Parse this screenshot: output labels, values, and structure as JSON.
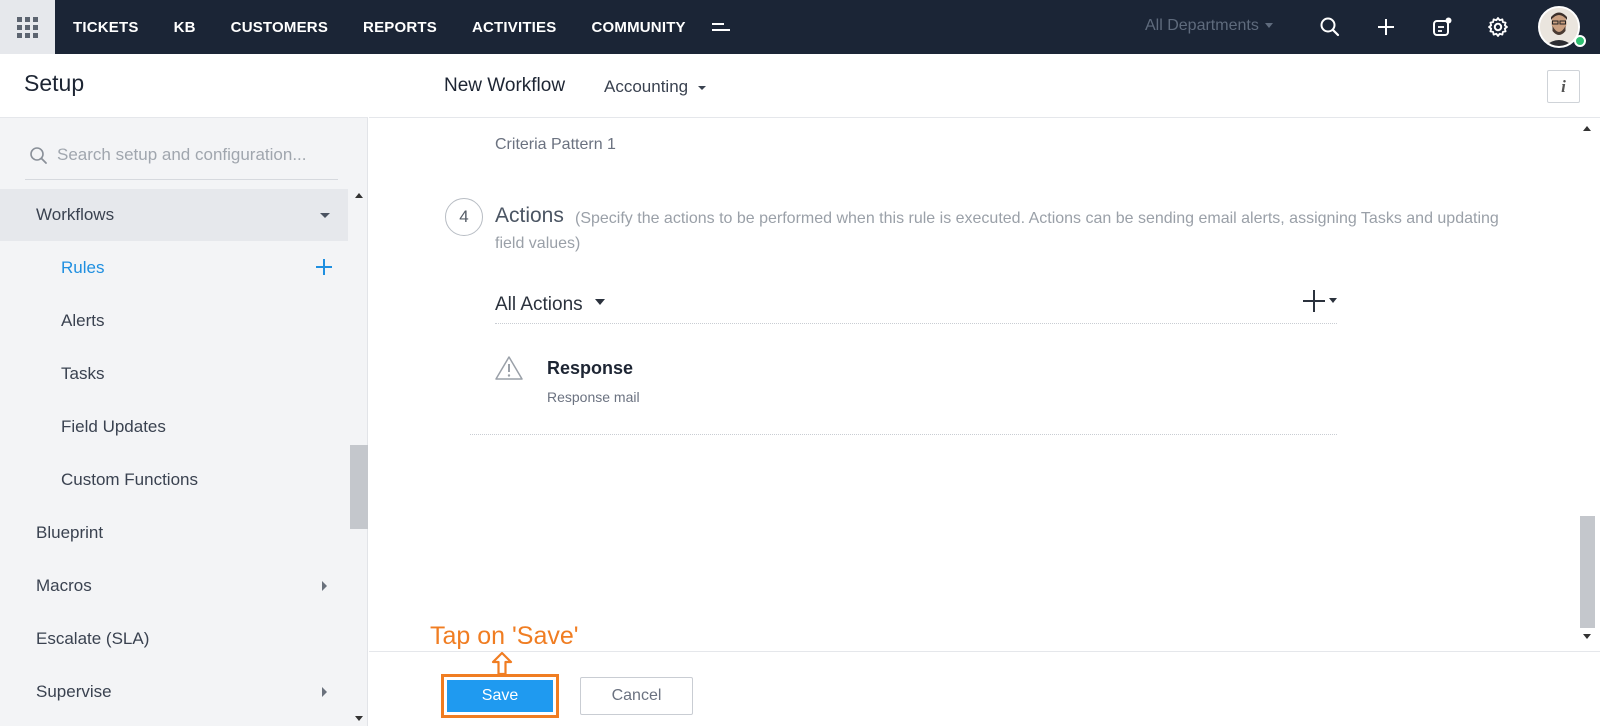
{
  "topnav": {
    "items": [
      "TICKETS",
      "KB",
      "CUSTOMERS",
      "REPORTS",
      "ACTIVITIES",
      "COMMUNITY"
    ],
    "department": "All Departments",
    "icons": [
      "apps-grid-icon",
      "more-menu-icon",
      "search-icon",
      "plus-icon",
      "compose-icon",
      "gear-icon"
    ]
  },
  "sidebar": {
    "title": "Setup",
    "search_placeholder": "Search setup and configuration...",
    "group": "Workflows",
    "sub_items": [
      "Rules",
      "Alerts",
      "Tasks",
      "Field Updates",
      "Custom Functions"
    ],
    "selected": "Rules",
    "items": [
      "Blueprint",
      "Macros",
      "Escalate (SLA)",
      "Supervise"
    ]
  },
  "main": {
    "title": "New Workflow",
    "department": "Accounting",
    "info_label": "i",
    "criteria_pattern": "Criteria Pattern 1",
    "step_number": "4",
    "actions_title": "Actions",
    "actions_desc": "(Specify the actions to be performed when this rule is executed. Actions can be sending email alerts, assigning Tasks and updating field values)",
    "all_actions_label": "All Actions",
    "action": {
      "title": "Response",
      "subtitle": "Response mail"
    }
  },
  "footer": {
    "save_label": "Save",
    "cancel_label": "Cancel"
  },
  "annotation": {
    "text": "Tap on 'Save'",
    "color": "#f07d22"
  },
  "colors": {
    "topbar": "#1b2536",
    "accent": "#1f9af0",
    "selected_text": "#1f8fe0"
  }
}
